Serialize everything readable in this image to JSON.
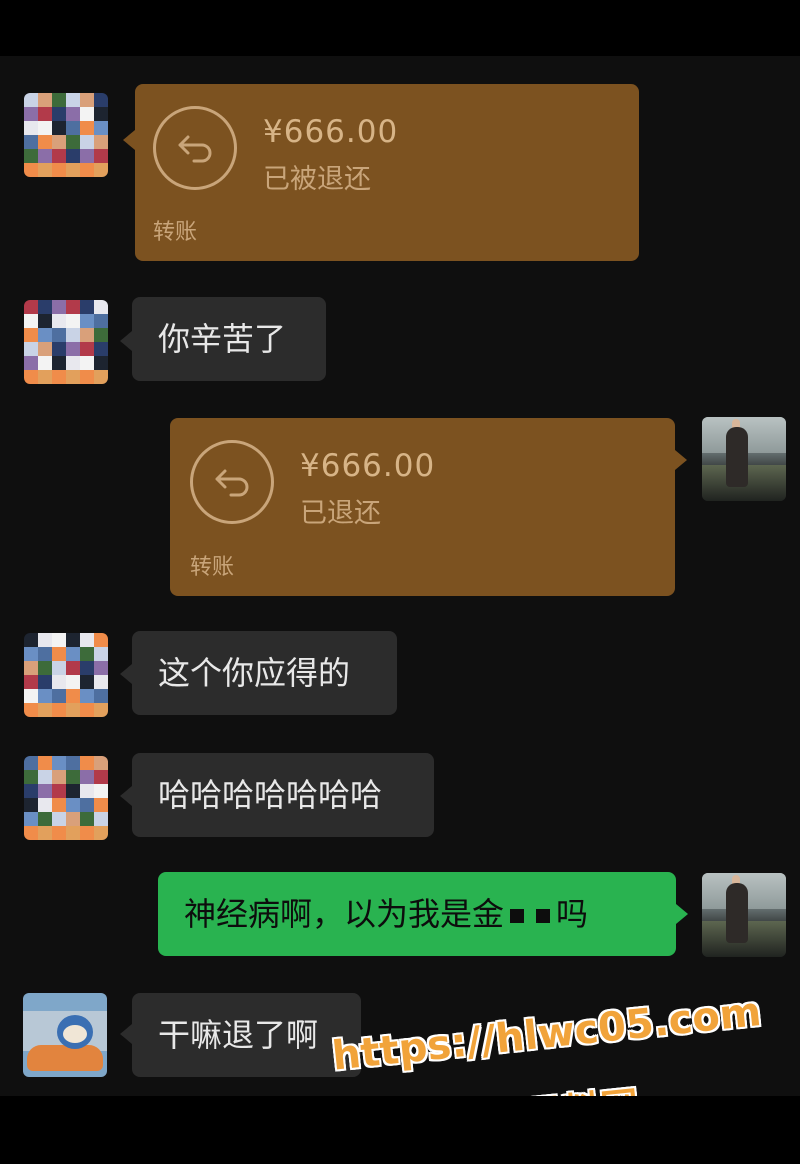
{
  "messages": [
    {
      "sender": "other",
      "type": "transfer",
      "amount": "¥666.00",
      "status": "已被退还",
      "label": "转账"
    },
    {
      "sender": "other",
      "type": "text",
      "text": "你辛苦了"
    },
    {
      "sender": "self",
      "type": "transfer",
      "amount": "¥666.00",
      "status": "已退还",
      "label": "转账"
    },
    {
      "sender": "other",
      "type": "text",
      "text": "这个你应得的"
    },
    {
      "sender": "other",
      "type": "text",
      "text": "哈哈哈哈哈哈哈"
    },
    {
      "sender": "self",
      "type": "text",
      "text_before": "神经病啊，以为我是金",
      "text_after": "吗"
    },
    {
      "sender": "other2",
      "type": "text",
      "text": "干嘛退了啊"
    }
  ],
  "watermark": {
    "url": "https://hlwc05.com",
    "name": "黑料网"
  },
  "colors": {
    "background": "#0f0f0f",
    "incoming_bubble": "#2c2c2c",
    "outgoing_bubble": "#29b350",
    "transfer_bubble": "#7c5220",
    "watermark": "#f1a33a"
  },
  "icons": {
    "transfer_icon": "return-arrow-icon",
    "avatar_other": "pixelated-avatar",
    "avatar_self": "photo-avatar",
    "avatar_other2": "cartoon-avatar"
  }
}
